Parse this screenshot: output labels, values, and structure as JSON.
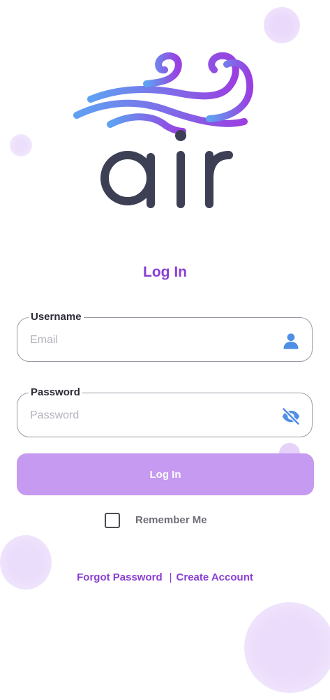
{
  "brand": {
    "logo_text": "air"
  },
  "heading": "Log In",
  "username": {
    "label": "Username",
    "placeholder": "Email",
    "value": "",
    "icon": "user-icon"
  },
  "password": {
    "label": "Password",
    "placeholder": "Password",
    "value": "",
    "icon": "eye-off-icon"
  },
  "login_button": "Log In",
  "remember_me": {
    "label": "Remember Me",
    "checked": false
  },
  "links": {
    "forgot": "Forgot Password",
    "separator": "|",
    "create": "Create Account"
  },
  "colors": {
    "accent": "#8a3ed4",
    "button": "#c59af0",
    "icon_blue": "#4f8fe6",
    "logo_dark": "#3d3f55",
    "gradient_start": "#5ea1f2",
    "gradient_end": "#9a3fe0"
  }
}
